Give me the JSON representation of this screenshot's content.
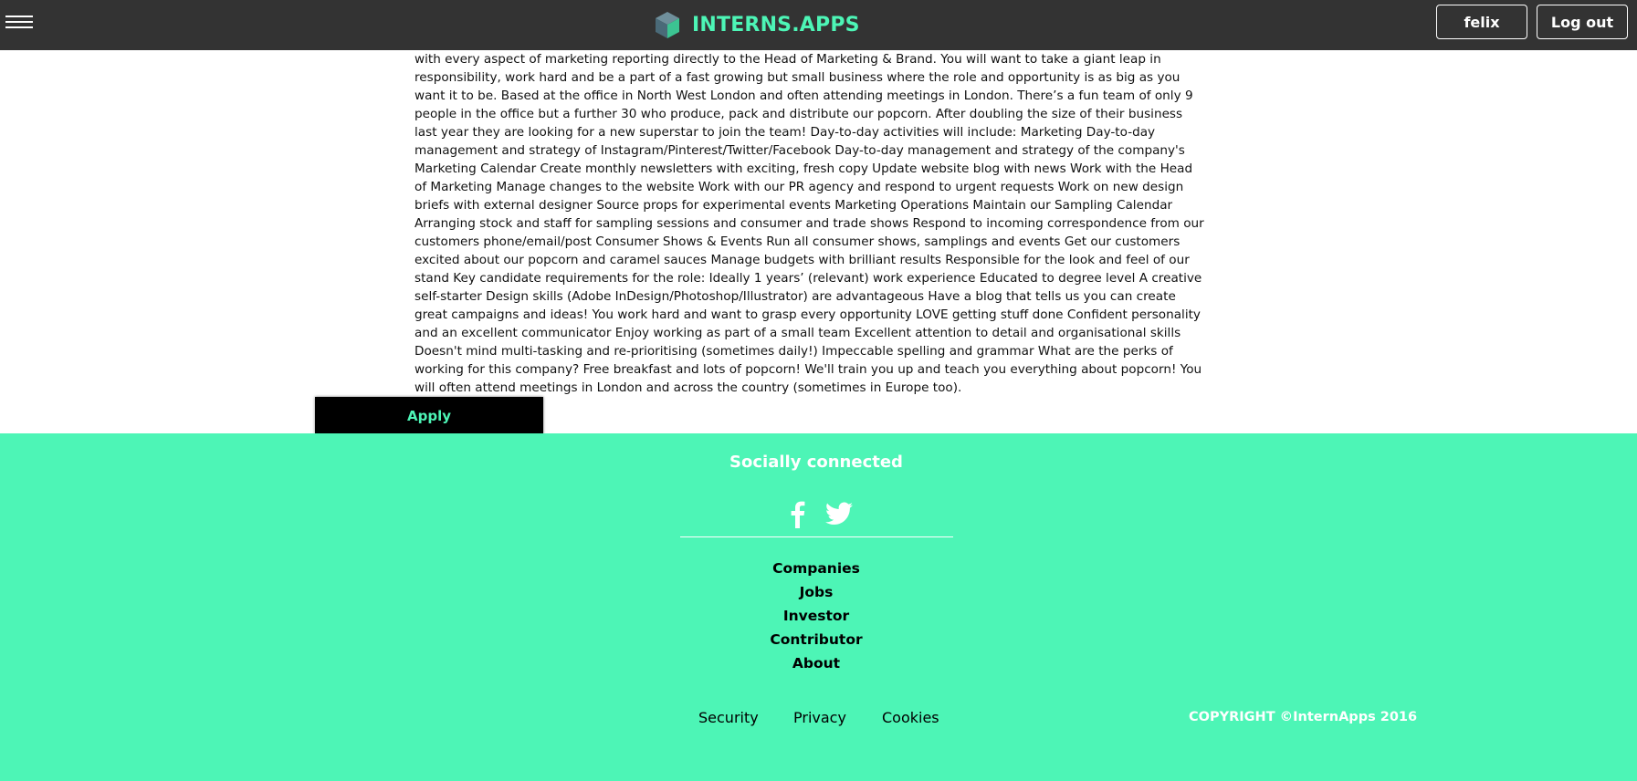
{
  "header": {
    "brand": "INTERNS.APPS",
    "user_label": "felix",
    "logout_label": "Log out",
    "accent_color": "#4df5b6",
    "bar_color": "#333333",
    "icons": [
      "menu-icon",
      "cube-logo-icon"
    ]
  },
  "job": {
    "description": "with every aspect of marketing reporting directly to the Head of Marketing & Brand. You will want to take a giant leap in responsibility, work hard and be a part of a fast growing but small business where the role and opportunity is as big as you want it to be. Based at the office in North West London and often attending meetings in London. There’s a fun team of only 9 people in the office but a further 30 who produce, pack and distribute our popcorn. After doubling the size of their business last year they are looking for a new superstar to join the team! Day-to-day activities will include: Marketing Day-to-day management and strategy of Instagram/Pinterest/Twitter/Facebook Day-to-day management and strategy of the company's Marketing Calendar Create monthly newsletters with exciting, fresh copy Update website blog with news Work with the Head of Marketing Manage changes to the website Work with our PR agency and respond to urgent requests Work on new design briefs with external designer Source props for experimental events Marketing Operations Maintain our Sampling Calendar Arranging stock and staff for sampling sessions and consumer and trade shows Respond to incoming correspondence from our customers phone/email/post Consumer Shows & Events Run all consumer shows, samplings and events Get our customers excited about our popcorn and caramel sauces Manage budgets with brilliant results Responsible for the look and feel of our stand Key candidate requirements for the role: Ideally 1 years’ (relevant) work experience Educated to degree level A creative self-starter Design skills (Adobe InDesign/Photoshop/Illustrator) are advantageous Have a blog that tells us you can create great campaigns and ideas! You work hard and want to grasp every opportunity LOVE getting stuff done Confident personality and an excellent communicator Enjoy working as part of a small team Excellent attention to detail and organisational skills Doesn't mind multi-tasking and re-prioritising (sometimes daily!) Impeccable spelling and grammar What are the perks of working for this company? Free breakfast and lots of popcorn! We'll train you up and teach you everything about popcorn! You will often attend meetings in London and across the country (sometimes in Europe too).",
    "apply_label": "Apply"
  },
  "footer": {
    "social_heading": "Socially connected",
    "social_icons": [
      "facebook-icon",
      "twitter-icon"
    ],
    "links": [
      {
        "label": "Companies"
      },
      {
        "label": "Jobs"
      },
      {
        "label": "Investor"
      },
      {
        "label": "Contributor"
      },
      {
        "label": "About"
      }
    ],
    "legal": {
      "security": "Security",
      "privacy": "Privacy",
      "cookies": "Cookies"
    },
    "copyright": "COPYRIGHT ©InternApps 2016",
    "background_color": "#4df5b6"
  }
}
